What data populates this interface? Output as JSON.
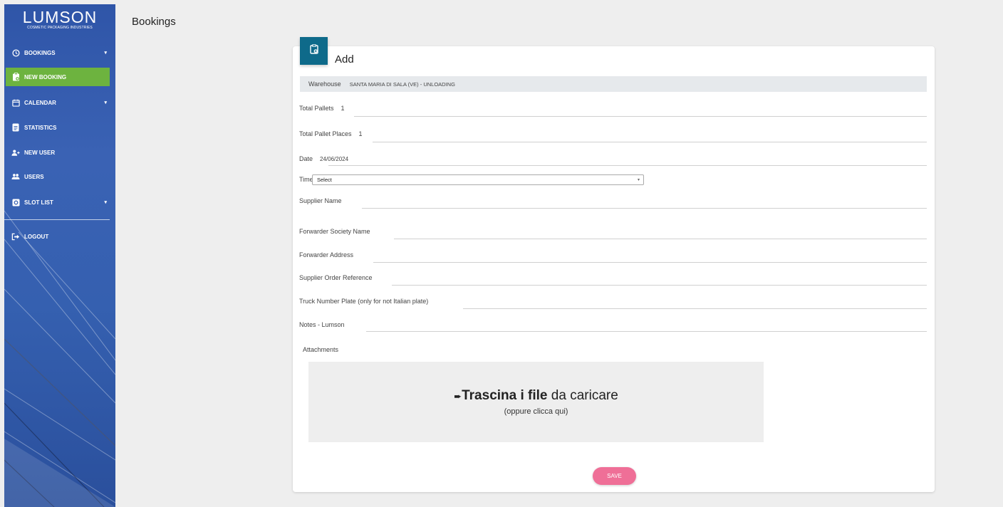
{
  "brand": {
    "name": "LUMSON",
    "tagline": "COSMETIC PACKAGING INDUSTRIES"
  },
  "sidebar": {
    "items": [
      {
        "label": "BOOKINGS",
        "icon": "clock-icon",
        "has_caret": true,
        "active": false
      },
      {
        "label": "NEW BOOKING",
        "icon": "clipboard-add-icon",
        "has_caret": false,
        "active": true
      },
      {
        "label": "CALENDAR",
        "icon": "calendar-icon",
        "has_caret": true,
        "active": false
      },
      {
        "label": "STATISTICS",
        "icon": "document-icon",
        "has_caret": false,
        "active": false
      },
      {
        "label": "NEW USER",
        "icon": "add-user-icon",
        "has_caret": false,
        "active": false
      },
      {
        "label": "USERS",
        "icon": "users-icon",
        "has_caret": false,
        "active": false
      },
      {
        "label": "SLOT LIST",
        "icon": "settings-box-icon",
        "has_caret": true,
        "active": false
      },
      {
        "label": "LOGOUT",
        "icon": "logout-icon",
        "has_caret": false,
        "active": false
      }
    ],
    "active_color": "#6db33f"
  },
  "header": {
    "title": "Bookings"
  },
  "card": {
    "title": "Add",
    "badge_icon": "clipboard-add-icon",
    "badge_color": "#0e6a8a"
  },
  "form": {
    "warehouse": {
      "label": "Warehouse",
      "value": "SANTA MARIA DI SALA (VE) - UNLOADING"
    },
    "total_pallets": {
      "label": "Total Pallets",
      "value": "1"
    },
    "total_pallet_places": {
      "label": "Total Pallet Places",
      "value": "1"
    },
    "date": {
      "label": "Date",
      "value": "24/06/2024"
    },
    "time": {
      "label": "Time",
      "value": "Select"
    },
    "supplier_name": {
      "label": "Supplier Name",
      "value": ""
    },
    "forwarder_society_name": {
      "label": "Forwarder Society Name",
      "value": ""
    },
    "forwarder_address": {
      "label": "Forwarder Address",
      "value": ""
    },
    "supplier_order_reference": {
      "label": "Supplier Order Reference",
      "value": ""
    },
    "truck_number_plate": {
      "label": "Truck Number Plate (only for not Italian plate)",
      "value": ""
    },
    "notes_lumson": {
      "label": "Notes - Lumson",
      "value": ""
    }
  },
  "attachments": {
    "label": "Attachments",
    "drop_bold": "Trascina i file",
    "drop_rest": "da caricare",
    "drop_sub": "(oppure clicca qui)"
  },
  "actions": {
    "save_label": "SAVE",
    "save_color": "#ef6f97"
  }
}
